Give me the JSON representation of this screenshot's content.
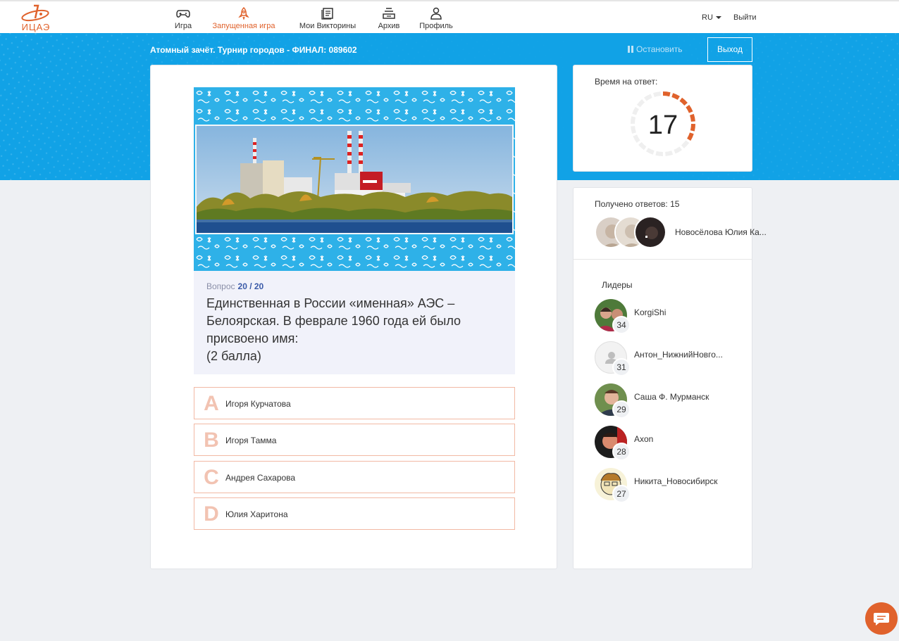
{
  "brand": {
    "logo_text": "ИЦАЭ",
    "accent": "#e0622c",
    "banner": "#11a2e6"
  },
  "nav": {
    "items": [
      {
        "label": "Игра",
        "icon": "gamepad-icon"
      },
      {
        "label": "Запущенная игра",
        "icon": "rocket-icon",
        "active": true
      },
      {
        "label": "Мои Викторины",
        "icon": "quiz-list-icon"
      },
      {
        "label": "Архив",
        "icon": "archive-icon"
      },
      {
        "label": "Профиль",
        "icon": "user-icon"
      }
    ],
    "lang": "RU",
    "logout": "Выйти"
  },
  "game": {
    "title": "Атомный зачёт. Турнир городов - ФИНАЛ: 089602",
    "stop_label": "Остановить",
    "exit_label": "Выход"
  },
  "question": {
    "meta_label": "Вопрос",
    "number": "20 / 20",
    "text": "Единственная в России «именная» АЭС –\nБелоярская. В феврале 1960 года ей было\nприсвоено имя:\n(2 балла)"
  },
  "answers": [
    {
      "letter": "A",
      "label": "Игоря Курчатова"
    },
    {
      "letter": "B",
      "label": "Игоря Тамма"
    },
    {
      "letter": "C",
      "label": "Андрея Сахарова"
    },
    {
      "letter": "D",
      "label": "Юлия Харитона"
    }
  ],
  "timer": {
    "label": "Время на ответ:",
    "value": "17"
  },
  "responses": {
    "label": "Получено ответов: 15",
    "latest_name": "Новосёлова Юлия Ка..."
  },
  "leaders": {
    "title": "Лидеры",
    "items": [
      {
        "name": "KorgiShi",
        "score": "34"
      },
      {
        "name": "Антон_НижнийНовго...",
        "score": "31"
      },
      {
        "name": "Саша Ф. Мурманск",
        "score": "29"
      },
      {
        "name": "Axon",
        "score": "28"
      },
      {
        "name": "Никита_Новосибирск",
        "score": "27"
      }
    ]
  }
}
